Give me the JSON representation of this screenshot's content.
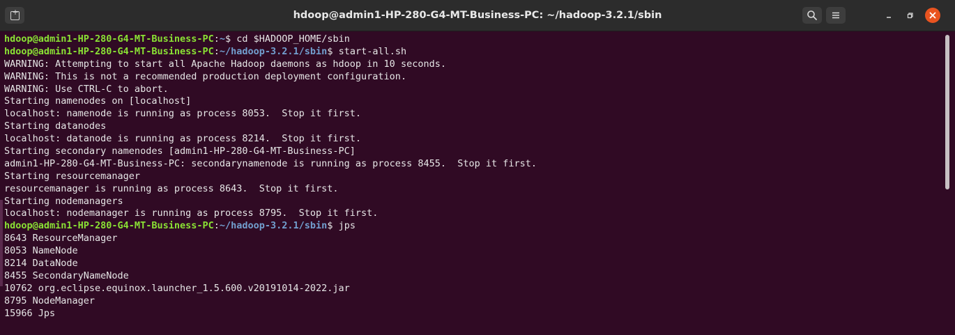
{
  "window": {
    "title": "hdoop@admin1-HP-280-G4-MT-Business-PC: ~/hadoop-3.2.1/sbin"
  },
  "icons": {
    "new_tab": "new-tab-icon",
    "search": "search-icon",
    "menu": "hamburger-menu-icon",
    "minimize": "minimize-icon",
    "maximize": "maximize-icon",
    "close": "close-icon"
  },
  "colors": {
    "background": "#300a24",
    "prompt_user": "#8ae234",
    "prompt_path": "#729fcf",
    "text": "#e6e6e6",
    "close_button": "#e95420"
  },
  "terminal": {
    "lines": [
      {
        "type": "prompt",
        "user": "hdoop@admin1-HP-280-G4-MT-Business-PC",
        "path": "~",
        "cmd": " cd $HADOOP_HOME/sbin"
      },
      {
        "type": "prompt",
        "user": "hdoop@admin1-HP-280-G4-MT-Business-PC",
        "path": "~/hadoop-3.2.1/sbin",
        "cmd": " start-all.sh"
      },
      {
        "type": "output",
        "text": "WARNING: Attempting to start all Apache Hadoop daemons as hdoop in 10 seconds."
      },
      {
        "type": "output",
        "text": "WARNING: This is not a recommended production deployment configuration."
      },
      {
        "type": "output",
        "text": "WARNING: Use CTRL-C to abort."
      },
      {
        "type": "output",
        "text": "Starting namenodes on [localhost]"
      },
      {
        "type": "output",
        "text": "localhost: namenode is running as process 8053.  Stop it first."
      },
      {
        "type": "output",
        "text": "Starting datanodes"
      },
      {
        "type": "output",
        "text": "localhost: datanode is running as process 8214.  Stop it first."
      },
      {
        "type": "output",
        "text": "Starting secondary namenodes [admin1-HP-280-G4-MT-Business-PC]"
      },
      {
        "type": "output",
        "text": "admin1-HP-280-G4-MT-Business-PC: secondarynamenode is running as process 8455.  Stop it first."
      },
      {
        "type": "output",
        "text": "Starting resourcemanager"
      },
      {
        "type": "output",
        "text": "resourcemanager is running as process 8643.  Stop it first."
      },
      {
        "type": "output",
        "text": "Starting nodemanagers"
      },
      {
        "type": "output",
        "text": "localhost: nodemanager is running as process 8795.  Stop it first."
      },
      {
        "type": "prompt",
        "user": "hdoop@admin1-HP-280-G4-MT-Business-PC",
        "path": "~/hadoop-3.2.1/sbin",
        "cmd": " jps"
      },
      {
        "type": "output",
        "text": "8643 ResourceManager"
      },
      {
        "type": "output",
        "text": "8053 NameNode"
      },
      {
        "type": "output",
        "text": "8214 DataNode"
      },
      {
        "type": "output",
        "text": "8455 SecondaryNameNode"
      },
      {
        "type": "output",
        "text": "10762 org.eclipse.equinox.launcher_1.5.600.v20191014-2022.jar"
      },
      {
        "type": "output",
        "text": "8795 NodeManager"
      },
      {
        "type": "output",
        "text": "15966 Jps"
      }
    ]
  }
}
